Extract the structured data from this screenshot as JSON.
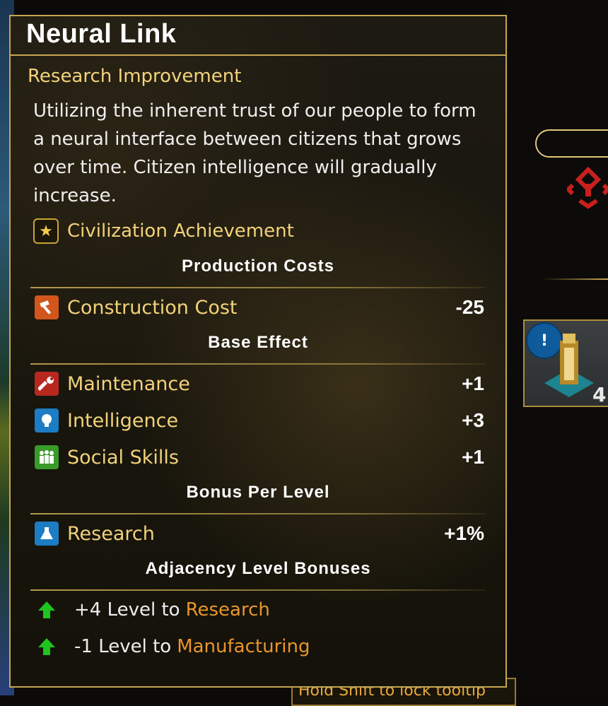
{
  "tooltip": {
    "title": "Neural Link",
    "subtitle": "Research Improvement",
    "description": "Utilizing the inherent trust of our people to form a neural interface between citizens that grows over time. Citizen intelligence will gradually increase.",
    "achievement": {
      "label": "Civilization Achievement",
      "icon": "star-icon"
    },
    "sections": {
      "production": {
        "header": "Production Costs",
        "rows": [
          {
            "label": "Construction Cost",
            "value": "-25",
            "icon": "hammer-icon",
            "color": "#d2561c"
          }
        ]
      },
      "base_effect": {
        "header": "Base Effect",
        "rows": [
          {
            "label": "Maintenance",
            "value": "+1",
            "icon": "wrench-icon",
            "color": "#b8281f"
          },
          {
            "label": "Intelligence",
            "value": "+3",
            "icon": "lightbulb-icon",
            "color": "#1c7cc4"
          },
          {
            "label": "Social Skills",
            "value": "+1",
            "icon": "people-icon",
            "color": "#3a9a2a"
          }
        ]
      },
      "bonus_per_level": {
        "header": "Bonus Per Level",
        "rows": [
          {
            "label": "Research",
            "value": "+1%",
            "icon": "flask-icon",
            "color": "#1c7cc4"
          }
        ]
      },
      "adjacency": {
        "header": "Adjacency Level Bonuses",
        "rows": [
          {
            "text": "+4 Level to",
            "target": "Research",
            "icon": "up-arrow-icon"
          },
          {
            "text": "-1 Level to",
            "target": "Manufacturing",
            "icon": "up-arrow-icon"
          }
        ]
      }
    }
  },
  "background": {
    "building_card": {
      "badge": "!",
      "level": "4"
    },
    "hint": "Hold Shift to lock tooltip"
  },
  "colors": {
    "accent_gold": "#c4a653",
    "label_gold": "#f2d27a",
    "target_orange": "#e9952d",
    "arrow_green": "#1fc41f"
  }
}
